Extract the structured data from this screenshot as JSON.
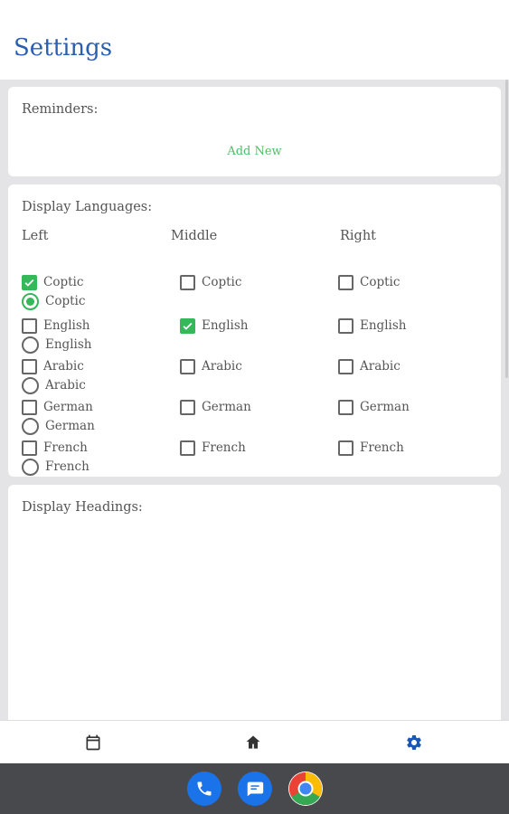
{
  "header": {
    "title": "Settings"
  },
  "reminders": {
    "title": "Reminders:",
    "add_new_label": "Add New"
  },
  "display_languages": {
    "title": "Display Languages:",
    "columns": [
      {
        "header": "Left",
        "options": [
          {
            "label": "Coptic",
            "checked": true
          },
          {
            "label": "English",
            "checked": false
          },
          {
            "label": "Arabic",
            "checked": false
          },
          {
            "label": "German",
            "checked": false
          },
          {
            "label": "French",
            "checked": false
          }
        ]
      },
      {
        "header": "Middle",
        "options": [
          {
            "label": "Coptic",
            "checked": false
          },
          {
            "label": "English",
            "checked": true
          },
          {
            "label": "Arabic",
            "checked": false
          },
          {
            "label": "German",
            "checked": false
          },
          {
            "label": "French",
            "checked": false
          }
        ]
      },
      {
        "header": "Right",
        "options": [
          {
            "label": "Coptic",
            "checked": false
          },
          {
            "label": "English",
            "checked": false
          },
          {
            "label": "Arabic",
            "checked": false
          },
          {
            "label": "German",
            "checked": false
          },
          {
            "label": "French",
            "checked": false
          }
        ]
      }
    ]
  },
  "display_headings": {
    "title": "Display Headings:",
    "options": [
      {
        "label": "Coptic",
        "selected": true
      },
      {
        "label": "English",
        "selected": false
      },
      {
        "label": "Arabic",
        "selected": false
      },
      {
        "label": "German",
        "selected": false
      },
      {
        "label": "French",
        "selected": false
      }
    ]
  },
  "bottom_nav": {
    "items": [
      {
        "icon": "calendar-icon",
        "active": false
      },
      {
        "icon": "home-icon",
        "active": false
      },
      {
        "icon": "gear-icon",
        "active": true
      }
    ],
    "active_color": "#1a56b8",
    "inactive_color": "#333333"
  },
  "dock": {
    "apps": [
      {
        "icon": "phone-icon",
        "color": "#1a73e8"
      },
      {
        "icon": "messages-icon",
        "color": "#1a73e8"
      },
      {
        "icon": "chrome-icon",
        "color": "#ea4335"
      }
    ]
  },
  "colors": {
    "accent": "#34b85a",
    "title": "#2b5fae",
    "link": "#4cbf64"
  }
}
